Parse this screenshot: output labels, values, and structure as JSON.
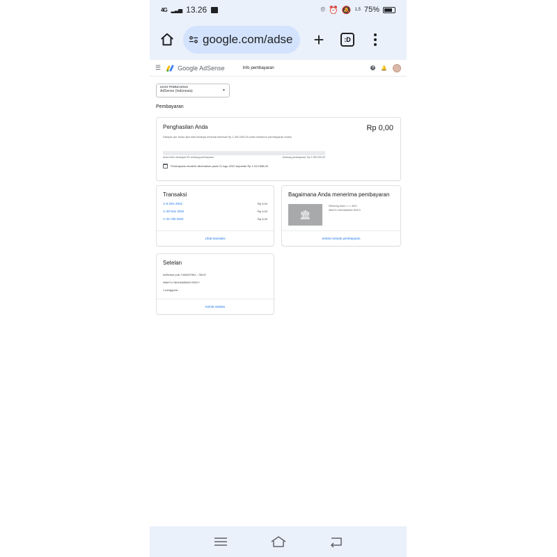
{
  "status_bar": {
    "network": "4G",
    "time": "13.26",
    "battery": "75%",
    "battery_level": 0.75,
    "speed": "1,5"
  },
  "browser": {
    "url": "google.com/adse",
    "tabs_count": ":D"
  },
  "adsense_header": {
    "app_name": "Google AdSense",
    "section": "Info pembayaran",
    "help_icon": "help-icon",
    "notification_icon": "bell-icon"
  },
  "account_selector": {
    "label": "AKUN PEMBAYARAN",
    "value": "AdSense (Indonesia)"
  },
  "page_title": "Pembayaran",
  "earnings": {
    "title": "Penghasilan Anda",
    "amount": "Rp 0,00",
    "description": "Dibayar per bulan jika nilai totalnya minimal sebesar Rp 1.300.000,00 (nilai minimum pembayaran Anda)",
    "progress_fraction": 0,
    "progress_left": "Anda telah mencapai 0% ambang pembayaran",
    "progress_right": "Ambang pembayaran: Rp 1.300.000,00",
    "last_payment": "Pembayaran terakhir dikeluarkan pada 21 Agu 2022 sejumlah Rp 1.513.588,00"
  },
  "transactions": {
    "title": "Transaksi",
    "rows": [
      {
        "period": "1–8 Des 2022",
        "amount": "Rp 0,00"
      },
      {
        "period": "1–30 Nov 2022",
        "amount": "Rp 0,00"
      },
      {
        "period": "1–31 Okt 2022",
        "amount": "Rp 0,00"
      }
    ],
    "footer_link": "Lihat transaksi"
  },
  "payment_method": {
    "title": "Bagaimana Anda menerima pembayaran",
    "bank_line": "Rekening bank • • • • 4521",
    "holder": "WAHYU MUHAMMAD RIZKY",
    "footer_link": "Kelola metode pembayaran"
  },
  "settings": {
    "title": "Setelan",
    "publisher_id": "AdSense pub-7445457961...75b47",
    "name": "WAHYU MUHAMMAD RIZKY",
    "users_link": "1 pengguna",
    "footer_link": "Kelola setelan"
  },
  "colors": {
    "accent": "#1a73e8",
    "browser_bg": "#eaf1fb",
    "url_pill": "#d3e3fd"
  }
}
